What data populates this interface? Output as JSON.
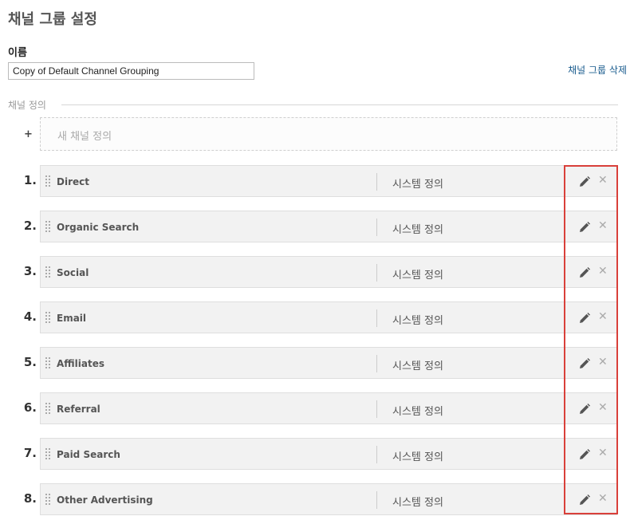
{
  "page": {
    "title": "채널 그룹 설정",
    "name_label": "이름",
    "name_value": "Copy of Default Channel Grouping",
    "delete_link": "채널 그룹 삭제",
    "section_title": "채널 정의",
    "add_symbol": "+",
    "new_channel_label": "새 채널 정의"
  },
  "channels": [
    {
      "num": "1.",
      "name": "Direct",
      "type": "시스템 정의"
    },
    {
      "num": "2.",
      "name": "Organic Search",
      "type": "시스템 정의"
    },
    {
      "num": "3.",
      "name": "Social",
      "type": "시스템 정의"
    },
    {
      "num": "4.",
      "name": "Email",
      "type": "시스템 정의"
    },
    {
      "num": "5.",
      "name": "Affiliates",
      "type": "시스템 정의"
    },
    {
      "num": "6.",
      "name": "Referral",
      "type": "시스템 정의"
    },
    {
      "num": "7.",
      "name": "Paid Search",
      "type": "시스템 정의"
    },
    {
      "num": "8.",
      "name": "Other Advertising",
      "type": "시스템 정의"
    }
  ],
  "icons": {
    "edit": "pencil-icon",
    "delete": "close-icon",
    "close_glyph": "✕",
    "drag": "drag-handle-icon"
  },
  "colors": {
    "highlight": "#d9403a",
    "link": "#1a5c8e",
    "row_bg": "#f2f2f2"
  }
}
